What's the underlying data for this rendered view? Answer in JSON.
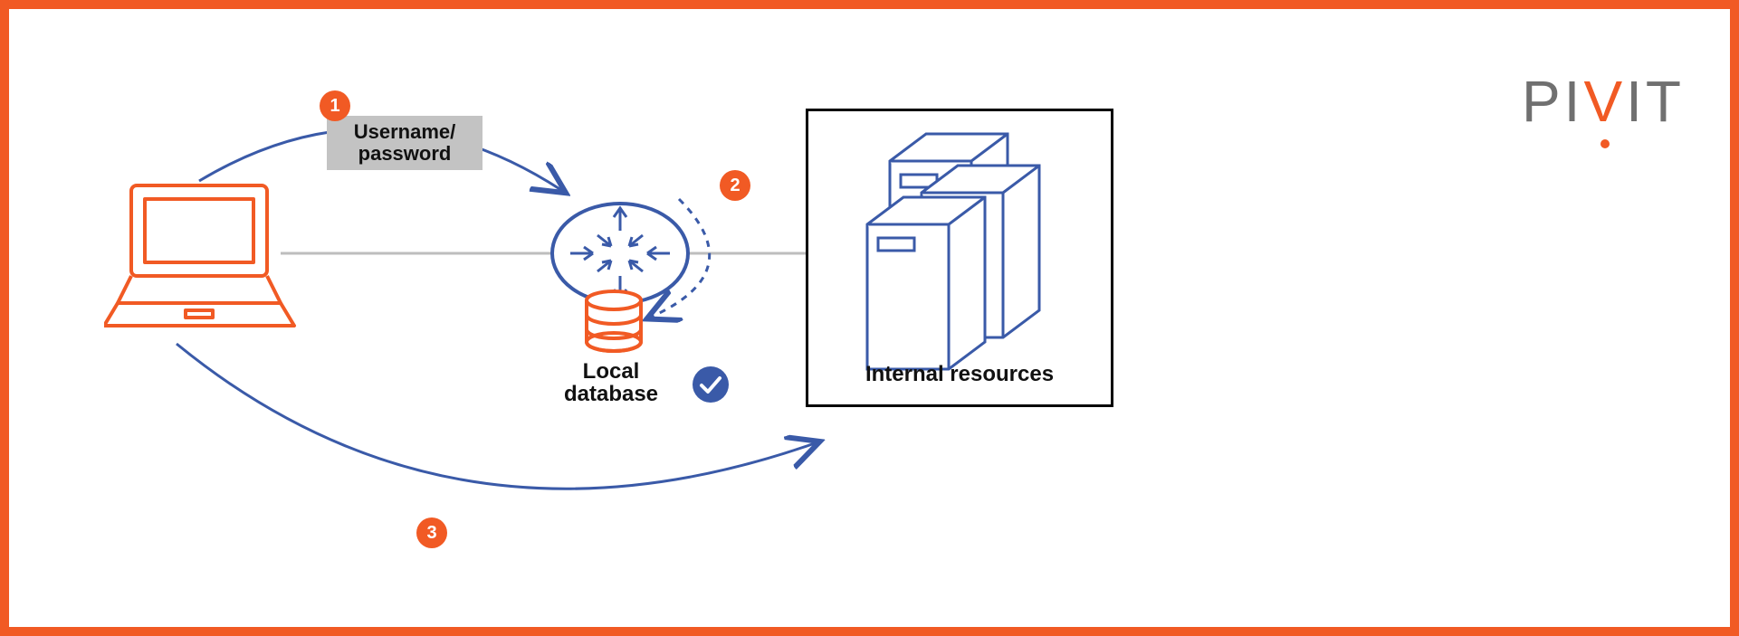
{
  "brand": {
    "name": "PIVIT"
  },
  "steps": {
    "s1": "1",
    "s2": "2",
    "s3": "3"
  },
  "credentials": {
    "line1": "Username/",
    "line2": "password"
  },
  "labels": {
    "local_db_line1": "Local",
    "local_db_line2": "database",
    "internal_resources": "Internal resources"
  },
  "colors": {
    "accent": "#f15a24",
    "blue_stroke": "#3a5aa8",
    "gray_line": "#bdbdbd",
    "badge_blue": "#3a5aa8",
    "box_gray": "#c3c3c3"
  },
  "flow": {
    "description": "Client sends username/password (1) to router; router verifies against local database (2); upon success client accesses internal resources (3).",
    "edges": [
      {
        "id": 1,
        "from": "laptop",
        "to": "router",
        "style": "solid-arrow",
        "label_ref": "credentials"
      },
      {
        "id": 2,
        "from": "router",
        "to": "local-database",
        "style": "dashed-arrow-loop"
      },
      {
        "id": 3,
        "from": "laptop",
        "to": "internal-resources",
        "style": "solid-arrow"
      }
    ],
    "nodes": [
      "laptop",
      "router",
      "local-database",
      "internal-resources"
    ]
  }
}
